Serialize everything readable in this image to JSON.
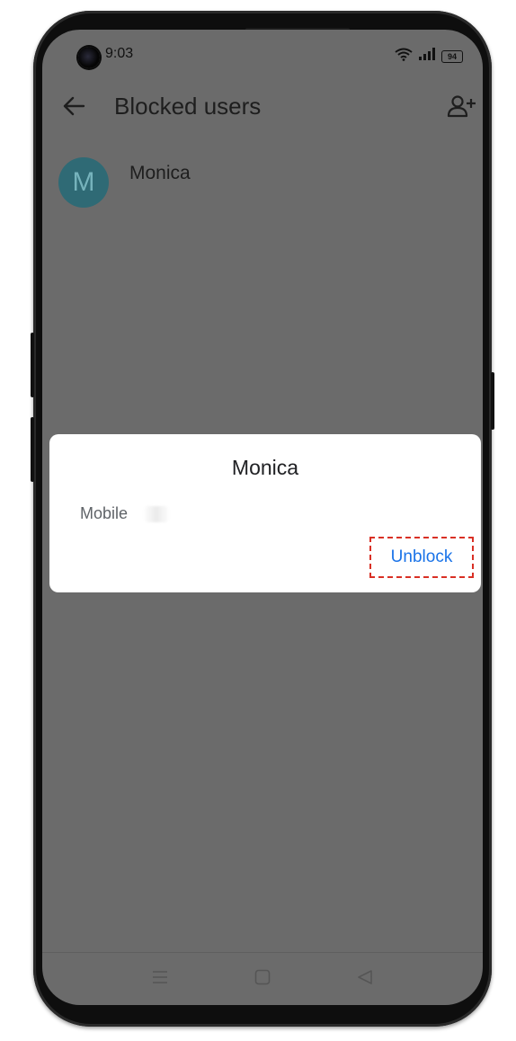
{
  "status_bar": {
    "time": "9:03",
    "battery": "94",
    "icons": [
      "wifi-icon",
      "signal-icon",
      "battery-icon"
    ]
  },
  "app_bar": {
    "title": "Blocked users",
    "back_icon": "arrow-back-icon",
    "add_icon": "add-person-icon"
  },
  "blocked_list": [
    {
      "initial": "M",
      "name": "Monica",
      "avatar_color": "#2f6a75"
    }
  ],
  "dialog": {
    "title": "Monica",
    "label": "Mobile",
    "action_label": "Unblock"
  },
  "nav_bar": {
    "icons": [
      "menu-icon",
      "home-icon",
      "back-triangle-icon"
    ]
  },
  "colors": {
    "scrim": "#6b6b6b",
    "accent": "#1a73e8",
    "highlight": "#d93025",
    "phone_body": "#0e0e0e"
  }
}
